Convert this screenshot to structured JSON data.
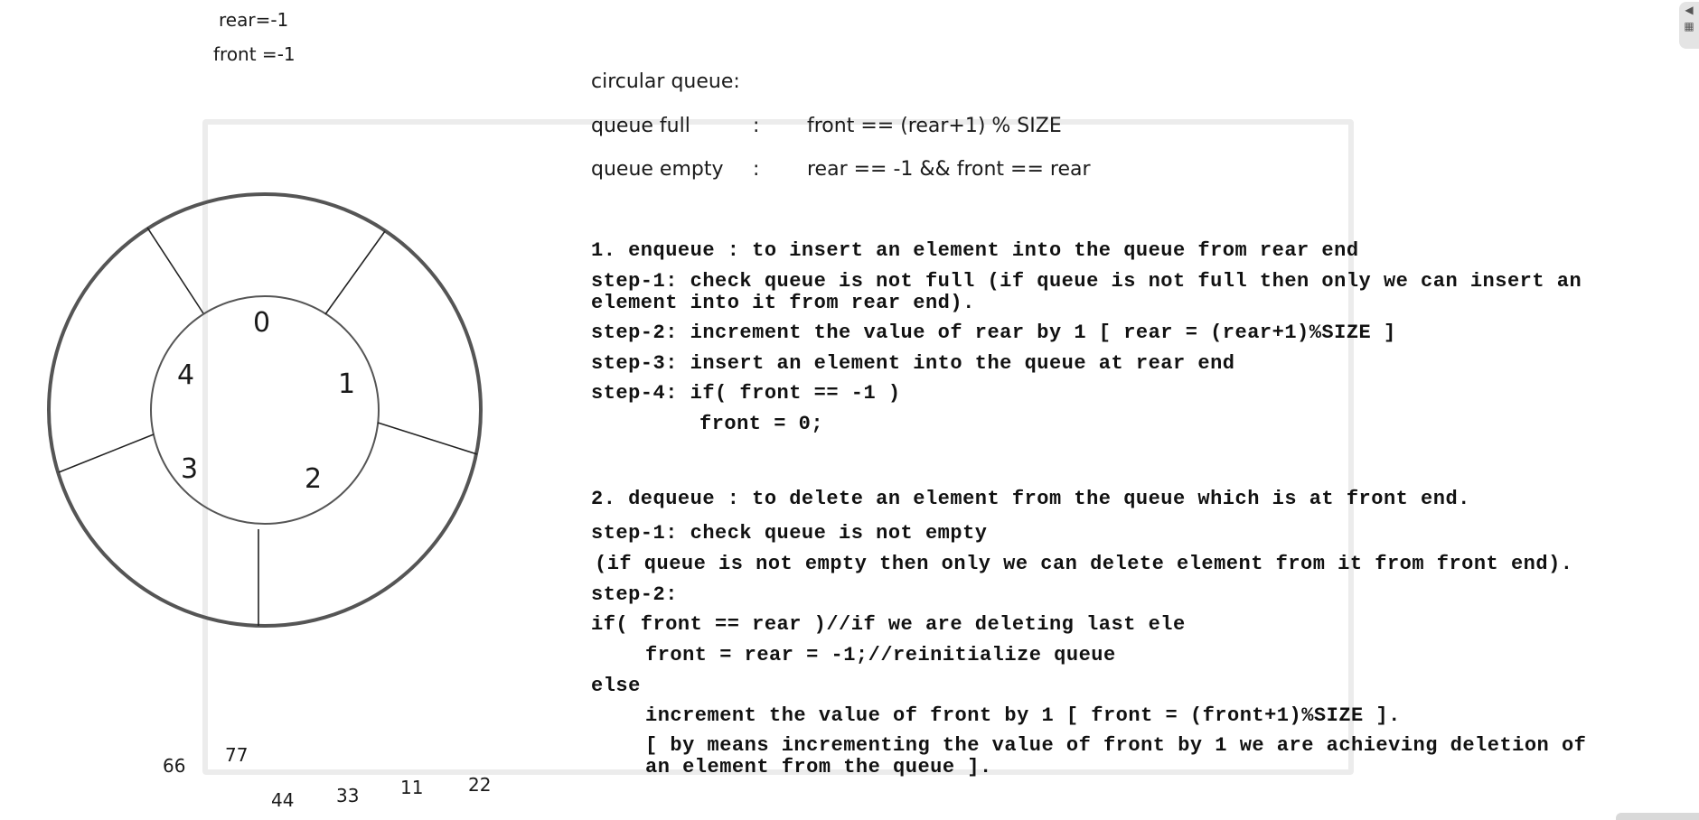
{
  "vars": {
    "rear": "rear=-1",
    "front": "front =-1"
  },
  "header": {
    "title": "circular queue:",
    "full_label": "queue full",
    "full_colon": ":",
    "full_expr": "front == (rear+1) % SIZE",
    "empty_label": "queue empty",
    "empty_colon": ":",
    "empty_expr": "rear == -1 && front == rear"
  },
  "enqueue": {
    "heading": "1. enqueue : to insert an element into the queue from rear end",
    "step1_a": "step-1: check queue is not full (if queue is not full then only we can insert an",
    "step1_b": "element into it from rear end).",
    "step2": "step-2: increment the value of rear by 1 [ rear = (rear+1)%SIZE ]",
    "step3": "step-3: insert an element into the queue at rear end",
    "step4": "step-4: if( front == -1 )",
    "step4_body": "front = 0;"
  },
  "dequeue": {
    "heading": "2. dequeue : to delete an element from the queue which is at front end.",
    "step1": "step-1: check queue is not empty",
    "step1_note": "(if queue is not empty then only we can delete element from it from front end).",
    "step2": "step-2:",
    "if_line": "if( front == rear )//if we are deleting last ele",
    "if_body": "front = rear = -1;//reinitialize queue",
    "else_line": "else",
    "else_body": "increment the value of front by 1 [ front = (front+1)%SIZE ].",
    "note_a": "[ by means incrementing the value of front by 1 we are achieving deletion of",
    "note_b": "an element from the queue ]."
  },
  "ring_indices": [
    "0",
    "1",
    "2",
    "3",
    "4"
  ],
  "scattered_values": [
    "66",
    "77",
    "44",
    "33",
    "11",
    "22"
  ],
  "colors": {
    "ring_stroke": "#555555",
    "frame": "#ececec",
    "text": "#111111"
  }
}
